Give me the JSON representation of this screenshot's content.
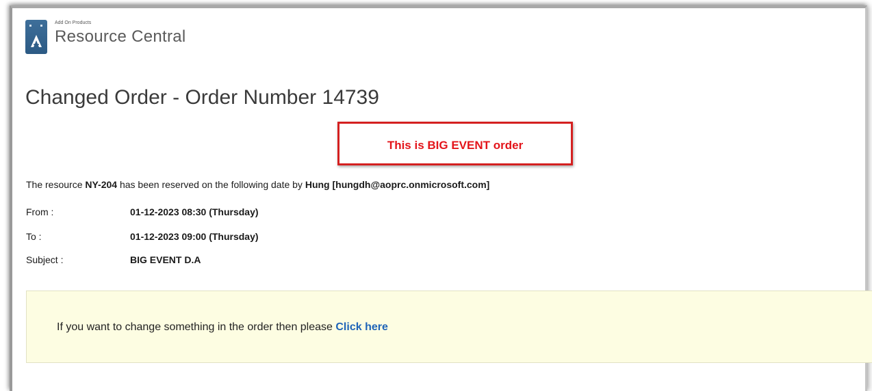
{
  "header": {
    "brand_small": "Add On Products",
    "brand_name": "Resource Central"
  },
  "title": "Changed Order - Order Number 14739",
  "highlight": "This is BIG EVENT order",
  "reservation": {
    "prefix": "The resource ",
    "resource": "NY-204",
    "middle": " has been reserved on the following date by ",
    "user": "Hung [hungdh@aoprc.onmicrosoft.com]"
  },
  "details": {
    "from_label": "From :",
    "from_value": "01-12-2023 08:30 (Thursday)",
    "to_label": "To :",
    "to_value": "01-12-2023 09:00 (Thursday)",
    "subject_label": "Subject :",
    "subject_value": "BIG EVENT D.A"
  },
  "notice": {
    "text": "If you want to change something in the order then please ",
    "link": "Click here"
  },
  "colors": {
    "highlight_text": "#e3141a",
    "highlight_border": "#d42020",
    "link": "#1f64b8",
    "notice_bg": "#fdfde2",
    "logo": "#2c5a84"
  },
  "icons": {
    "logo": "delta-triangle-icon"
  }
}
